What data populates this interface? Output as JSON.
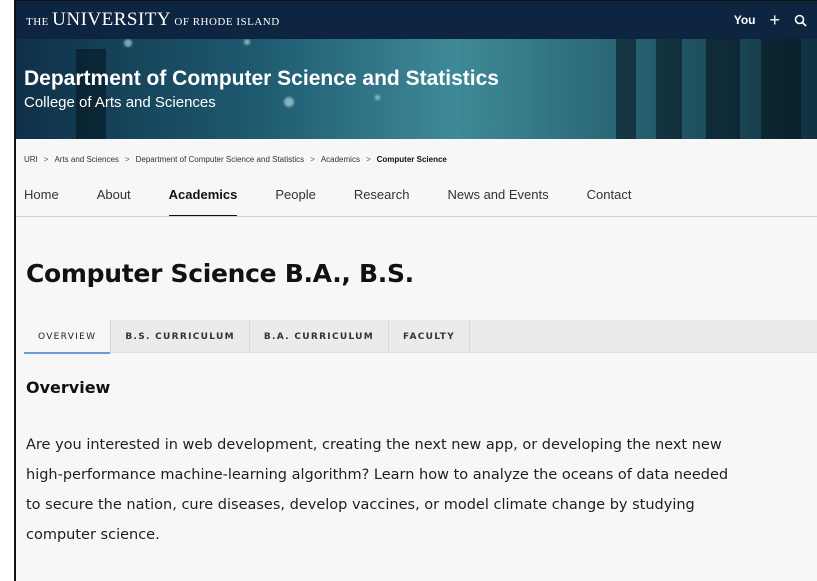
{
  "header": {
    "brand_the": "THE ",
    "brand_university": "UNIVERSITY",
    "brand_of": " OF RHODE ISLAND",
    "you_label": "You",
    "plus_label": "+",
    "search_icon": "search-icon"
  },
  "banner": {
    "department": "Department of Computer Science and Statistics",
    "college": "College of Arts and Sciences"
  },
  "breadcrumb": {
    "items": [
      "URI",
      "Arts and Sciences",
      "Department of Computer Science and Statistics",
      "Academics",
      "Computer Science"
    ],
    "separator": ">"
  },
  "nav": {
    "items": [
      "Home",
      "About",
      "Academics",
      "People",
      "Research",
      "News and Events",
      "Contact"
    ],
    "active": "Academics"
  },
  "page": {
    "title": "Computer Science B.A., B.S."
  },
  "tabs": {
    "items": [
      "OVERVIEW",
      "B.S. CURRICULUM",
      "B.A. CURRICULUM",
      "FACULTY"
    ],
    "active": "OVERVIEW"
  },
  "overview": {
    "heading": "Overview",
    "lines": [
      "Are you interested in web development, creating the next new app, or developing the next new",
      "high-performance machine-learning algorithm? Learn how to analyze the oceans of data needed",
      "to secure the nation, cure diseases, develop vaccines, or model climate change by studying",
      "computer science."
    ]
  },
  "colors": {
    "topbar": "#0d2540",
    "tab_active_underline": "#6e98d8"
  }
}
